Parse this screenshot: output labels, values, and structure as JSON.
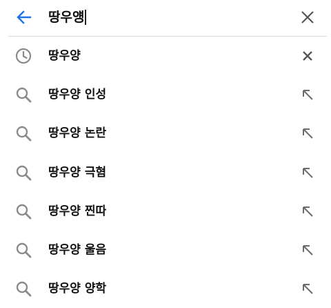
{
  "search": {
    "query": "땅우얭",
    "back_icon": "arrow-left-icon",
    "clear_icon": "close-icon"
  },
  "colors": {
    "accent": "#1a73e8",
    "icon_gray": "#8a8a8a",
    "text": "#111111",
    "divider": "#d8d8d8"
  },
  "history": [
    {
      "label": "땅우양",
      "icon": "history-clock-icon",
      "action_icon": "remove-icon"
    }
  ],
  "suggestions": [
    {
      "label": "땅우양 인성",
      "icon": "search-icon",
      "action_icon": "fill-query-arrow-icon"
    },
    {
      "label": "땅우양 논란",
      "icon": "search-icon",
      "action_icon": "fill-query-arrow-icon"
    },
    {
      "label": "땅우양 극혐",
      "icon": "search-icon",
      "action_icon": "fill-query-arrow-icon"
    },
    {
      "label": "땅우양 찐따",
      "icon": "search-icon",
      "action_icon": "fill-query-arrow-icon"
    },
    {
      "label": "땅우양 울음",
      "icon": "search-icon",
      "action_icon": "fill-query-arrow-icon"
    },
    {
      "label": "땅우양 양학",
      "icon": "search-icon",
      "action_icon": "fill-query-arrow-icon"
    }
  ]
}
